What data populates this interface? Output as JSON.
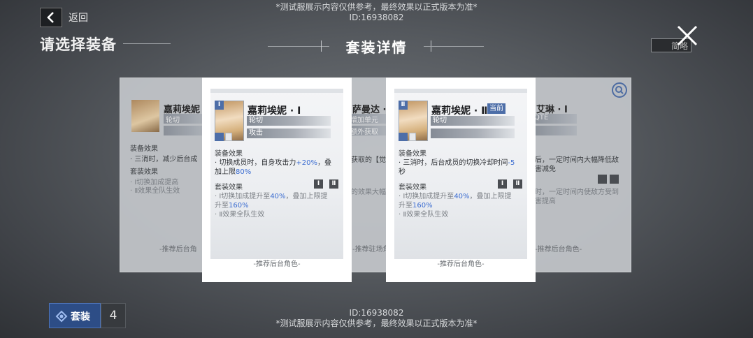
{
  "watermark": {
    "notice": "*测试服展示内容仅供参考，最终效果以正式版本为准*",
    "id": "ID:16938082"
  },
  "header": {
    "back_label": "返回",
    "page_title": "请选择装备",
    "toggle_label": "简略"
  },
  "modal": {
    "title": "套装详情"
  },
  "bg_cards": {
    "left": {
      "name": "嘉莉埃妮",
      "tag1": "轮切",
      "sec1": "装备效果",
      "line1": "· 三消时，减少后台成",
      "sec2": "套装效果",
      "line2": "· Ⅰ切换加成提高",
      "line3": "· Ⅱ效果全队生效",
      "bottom": "-推荐后台角"
    },
    "mid": {
      "name": "萨曼达 ·",
      "tag1": "增加单元",
      "tag2": "额外获取",
      "line1": "获取的【觉",
      "line2": "的效果大幅",
      "bottom": "-推荐驻场角"
    },
    "right": {
      "name": "艾琳 · Ⅰ",
      "tag1": "QTE",
      "line1": "后，一定时间内大幅降低敌",
      "line2": "害减免",
      "line3": "时，一定时间内使敌方受到",
      "line4": "害提高",
      "bottom": "-推荐后台角色-"
    }
  },
  "cards": [
    {
      "rank": "Ⅰ",
      "name": "嘉莉埃妮 · Ⅰ",
      "tags": [
        "轮切",
        "攻击"
      ],
      "equip_title": "装备效果",
      "equip_parts": [
        "· 切换成员时，自身攻击力",
        "+20%",
        "，叠加上限",
        "80%"
      ],
      "set_title": "套装效果",
      "set_parts": [
        "· Ⅰ切换加成提升至",
        "40%",
        "，叠加上限提升至",
        "160%"
      ],
      "set_line2": "· Ⅱ效果全队生效",
      "rank_boxes": [
        "Ⅰ",
        "Ⅱ"
      ],
      "recommend": "-推荐后台角色-"
    },
    {
      "rank": "Ⅱ",
      "name": "嘉莉埃妮 · Ⅱ",
      "current_tag": "当前",
      "tags": [
        "轮切"
      ],
      "equip_title": "装备效果",
      "equip_parts": [
        "· 三消时，后台成员的切换冷却时间",
        "-5",
        "秒"
      ],
      "set_title": "套装效果",
      "set_parts": [
        "· Ⅰ切换加成提升至",
        "40%",
        "，叠加上限提升至",
        "160%"
      ],
      "set_line2": "· Ⅱ效果全队生效",
      "rank_boxes": [
        "Ⅰ",
        "Ⅱ"
      ],
      "recommend": "-推荐后台角色-"
    }
  ],
  "footer": {
    "suit_label": "套装",
    "suit_count": "4"
  },
  "colors": {
    "accent": "#4d6ea8",
    "highlight": "#3d6ed1",
    "card_bg": "#ffffff"
  },
  "icons": [
    "back-arrow-icon",
    "close-icon",
    "search-icon",
    "suit-icon"
  ]
}
